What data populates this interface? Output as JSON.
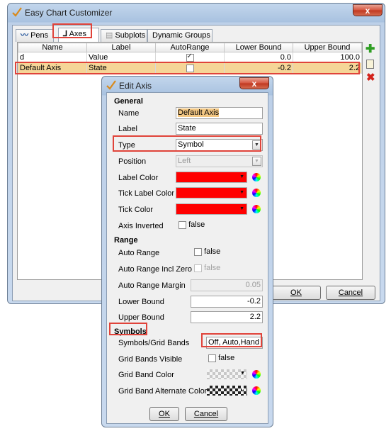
{
  "main_window": {
    "title": "Easy Chart Customizer",
    "close_label": "x",
    "tabs": [
      {
        "label": "Pens",
        "icon": "line-chart-icon"
      },
      {
        "label": "Axes",
        "icon": "axes-icon"
      },
      {
        "label": "Subplots",
        "icon": "subplots-icon"
      },
      {
        "label": "Dynamic Groups"
      }
    ],
    "table": {
      "columns": [
        "Name",
        "Label",
        "AutoRange",
        "Lower Bound",
        "Upper Bound"
      ],
      "rows": [
        {
          "name": "d",
          "label": "Value",
          "autorange": true,
          "lower": "0.0",
          "upper": "100.0"
        },
        {
          "name": "Default Axis",
          "label": "State",
          "autorange": false,
          "lower": "-0.2",
          "upper": "2.2"
        }
      ]
    },
    "side_icons": [
      "add-icon",
      "edit-icon",
      "delete-icon"
    ],
    "ok_label": "OK",
    "cancel_label": "Cancel"
  },
  "dialog": {
    "title": "Edit Axis",
    "close_label": "x",
    "sections": {
      "general": "General",
      "range": "Range",
      "symbols": "Symbols"
    },
    "fields": {
      "name": {
        "label": "Name",
        "value": "Default Axis"
      },
      "label": {
        "label": "Label",
        "value": "State"
      },
      "type": {
        "label": "Type",
        "value": "Symbol"
      },
      "position": {
        "label": "Position",
        "value": "Left"
      },
      "label_color": {
        "label": "Label Color",
        "value": "#ff0000"
      },
      "tick_label_color": {
        "label": "Tick Label Color",
        "value": "#ff0000"
      },
      "tick_color": {
        "label": "Tick Color",
        "value": "#ff0000"
      },
      "axis_inverted": {
        "label": "Axis Inverted",
        "value": "false"
      },
      "auto_range": {
        "label": "Auto Range",
        "value": "false"
      },
      "auto_range_incl_zero": {
        "label": "Auto Range Incl Zero",
        "value": "false"
      },
      "auto_range_margin": {
        "label": "Auto Range Margin",
        "value": "0.05"
      },
      "lower_bound": {
        "label": "Lower Bound",
        "value": "-0.2"
      },
      "upper_bound": {
        "label": "Upper Bound",
        "value": "2.2"
      },
      "symbols_grid_bands": {
        "label": "Symbols/Grid Bands",
        "value": "Off, Auto,Hand"
      },
      "grid_bands_visible": {
        "label": "Grid Bands Visible",
        "value": "false"
      },
      "grid_band_color": {
        "label": "Grid Band Color"
      },
      "grid_band_alt_color": {
        "label": "Grid Band Alternate Color"
      }
    },
    "ok_label": "OK",
    "cancel_label": "Cancel"
  },
  "colors": {
    "highlight": "#e0433a",
    "selected_row": "#f5d597",
    "name_selection": "#f3c783"
  }
}
